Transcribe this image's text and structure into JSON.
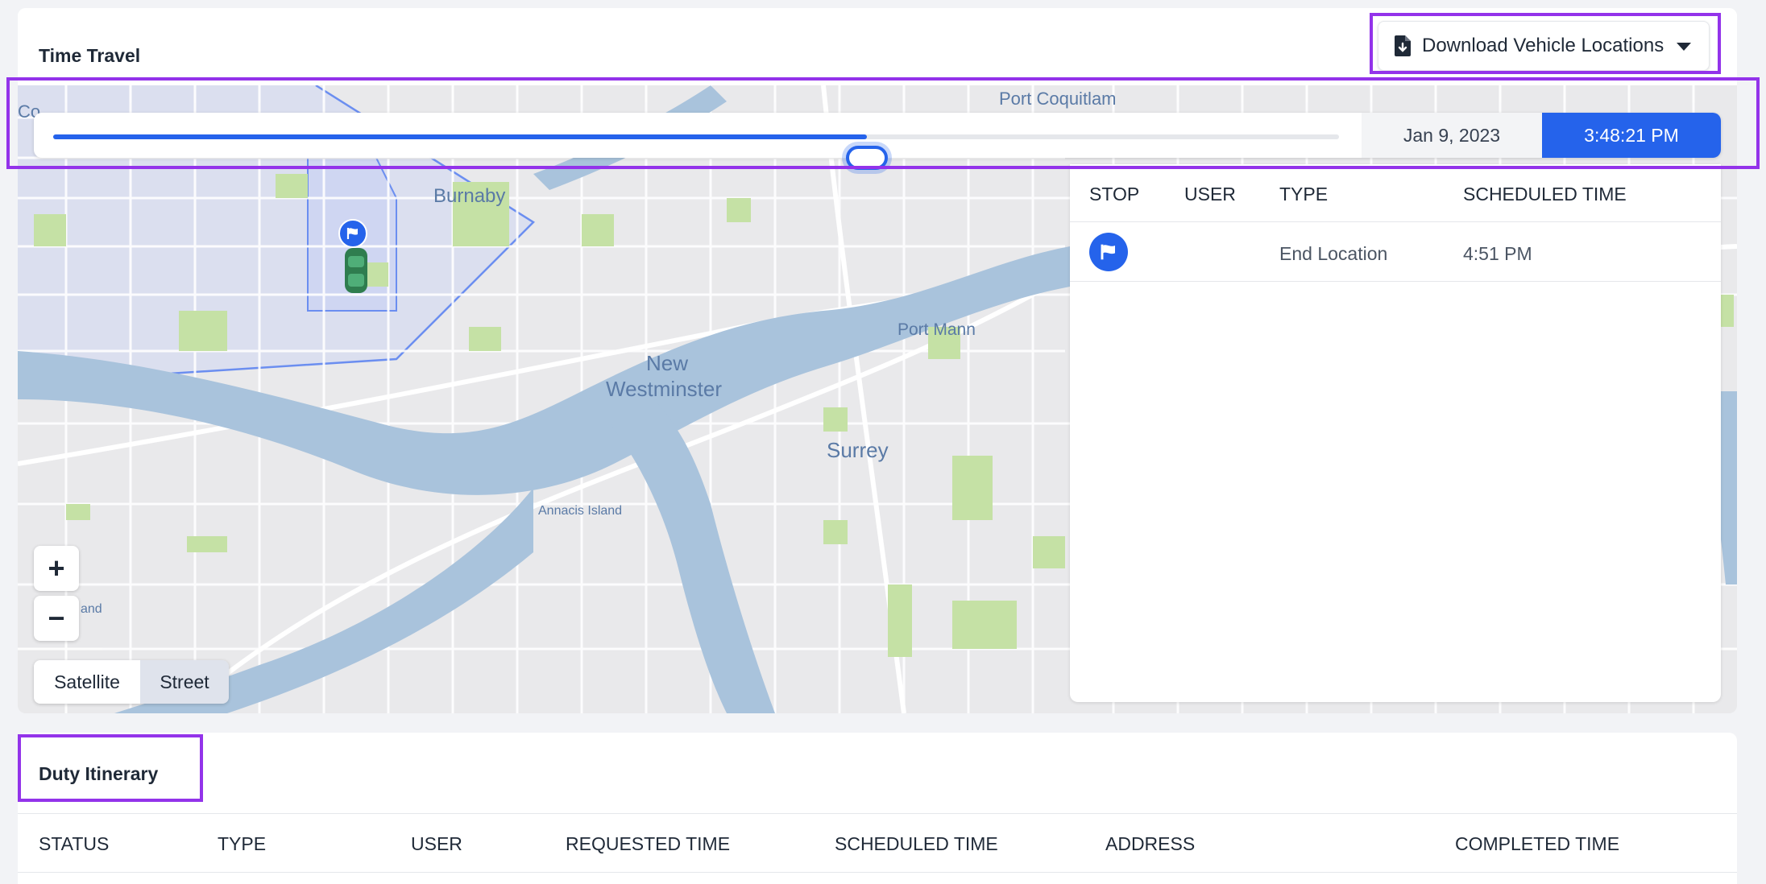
{
  "time_travel": {
    "title": "Time Travel",
    "download_button": {
      "label": "Download Vehicle Locations",
      "icon": "file-download-icon"
    },
    "slider": {
      "progress": 0.633,
      "date": "Jan 9, 2023",
      "time": "3:48:21 PM"
    },
    "stops_table": {
      "columns": [
        "STOP",
        "USER",
        "TYPE",
        "SCHEDULED TIME"
      ],
      "rows": [
        {
          "stop_icon": "flag-icon",
          "user": "",
          "type": "End Location",
          "scheduled_time": "4:51 PM"
        }
      ]
    },
    "map": {
      "labels": {
        "port_coquitlam": "Port Coquitlam",
        "burnaby": "Burnaby",
        "port_mann": "Port Mann",
        "new": "New",
        "westminster": "Westminster",
        "surrey": "Surrey",
        "annacis_island": "Annacis Island",
        "and": "and",
        "co": "Co"
      },
      "zoom_in": "+",
      "zoom_out": "−",
      "type_options": [
        "Satellite",
        "Street"
      ],
      "selected_type": "Street"
    }
  },
  "duty_itinerary": {
    "title": "Duty Itinerary",
    "columns": [
      "STATUS",
      "TYPE",
      "USER",
      "REQUESTED TIME",
      "SCHEDULED TIME",
      "ADDRESS",
      "COMPLETED TIME"
    ]
  },
  "colors": {
    "accent": "#2563eb",
    "highlight": "#9333ea",
    "water": "#a9c3dc",
    "park": "#c5e1a5"
  }
}
